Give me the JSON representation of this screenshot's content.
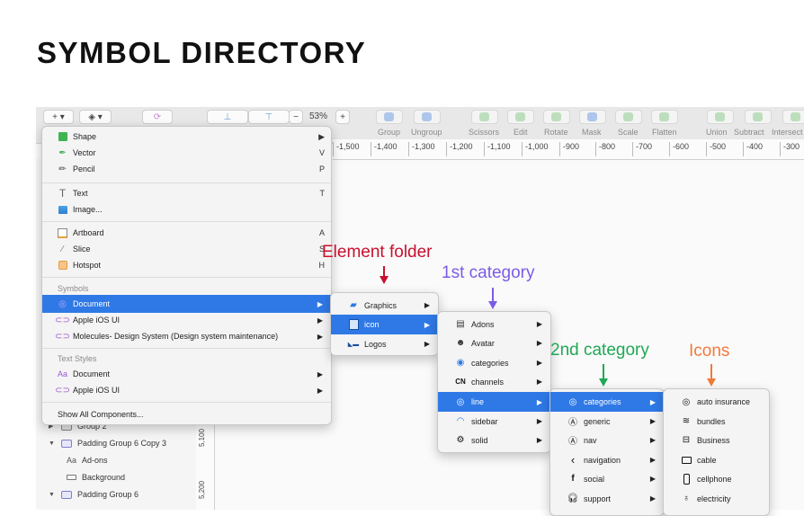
{
  "page_title": "SYMBOL DIRECTORY",
  "toolbar": {
    "insert_label": "+",
    "zoom_minus": "−",
    "zoom_value": "53%",
    "zoom_plus": "+",
    "labels": [
      "Group",
      "Ungroup",
      "Scissors",
      "Edit",
      "Rotate",
      "Mask",
      "Scale",
      "Flatten",
      "Union",
      "Subtract",
      "Intersect"
    ]
  },
  "ruler": {
    "ticks": [
      "-1,500",
      "-1,400",
      "-1,300",
      "-1,200",
      "-1,100",
      "-1,000",
      "-900",
      "-800",
      "-700",
      "-600",
      "-500",
      "-400",
      "-300"
    ],
    "vertical_ticks": [
      "5,100",
      "5,200"
    ]
  },
  "layers": [
    {
      "label": "Group 2"
    },
    {
      "label": "Padding Group 6 Copy 3"
    },
    {
      "label": "Ad-ons"
    },
    {
      "label": "Background"
    },
    {
      "label": "Padding Group 6"
    }
  ],
  "insert_menu": {
    "items": [
      {
        "label": "Shape",
        "shortcut": "▶"
      },
      {
        "label": "Vector",
        "shortcut": "V"
      },
      {
        "label": "Pencil",
        "shortcut": "P"
      },
      {
        "label": "Text",
        "shortcut": "T"
      },
      {
        "label": "Image...",
        "shortcut": ""
      },
      {
        "label": "Artboard",
        "shortcut": "A"
      },
      {
        "label": "Slice",
        "shortcut": "S"
      },
      {
        "label": "Hotspot",
        "shortcut": "H"
      }
    ],
    "symbols_header": "Symbols",
    "symbols": [
      {
        "label": "Document"
      },
      {
        "label": "Apple iOS UI"
      },
      {
        "label": "Molecules- Design System (Design system maintenance)"
      }
    ],
    "text_styles_header": "Text Styles",
    "text_styles": [
      {
        "label": "Document"
      },
      {
        "label": "Apple iOS UI"
      }
    ],
    "show_all": "Show All Components..."
  },
  "folder_menu": {
    "items": [
      {
        "label": "Graphics"
      },
      {
        "label": "icon"
      },
      {
        "label": "Logos"
      }
    ]
  },
  "category_menu": {
    "items": [
      {
        "label": "Adons"
      },
      {
        "label": "Avatar"
      },
      {
        "label": "categories"
      },
      {
        "label": "channels"
      },
      {
        "label": "line"
      },
      {
        "label": "sidebar"
      },
      {
        "label": "solid"
      }
    ]
  },
  "subcategory_menu": {
    "items": [
      {
        "label": "categories"
      },
      {
        "label": "generic"
      },
      {
        "label": "nav"
      },
      {
        "label": "navigation"
      },
      {
        "label": "social"
      },
      {
        "label": "support"
      }
    ]
  },
  "icons_menu": {
    "items": [
      {
        "label": "auto insurance"
      },
      {
        "label": "bundles"
      },
      {
        "label": "Business"
      },
      {
        "label": "cable"
      },
      {
        "label": "cellphone"
      },
      {
        "label": "electricity"
      }
    ]
  },
  "annotations": {
    "element_folder": "Element folder",
    "first_category": "1st category",
    "second_category": "2nd category",
    "icons": "Icons"
  },
  "colors": {
    "selection": "#2f79e6",
    "element_folder": "#c8102e",
    "first_category": "#7b5ce6",
    "second_category": "#1fa855",
    "icons": "#f07a3a"
  }
}
